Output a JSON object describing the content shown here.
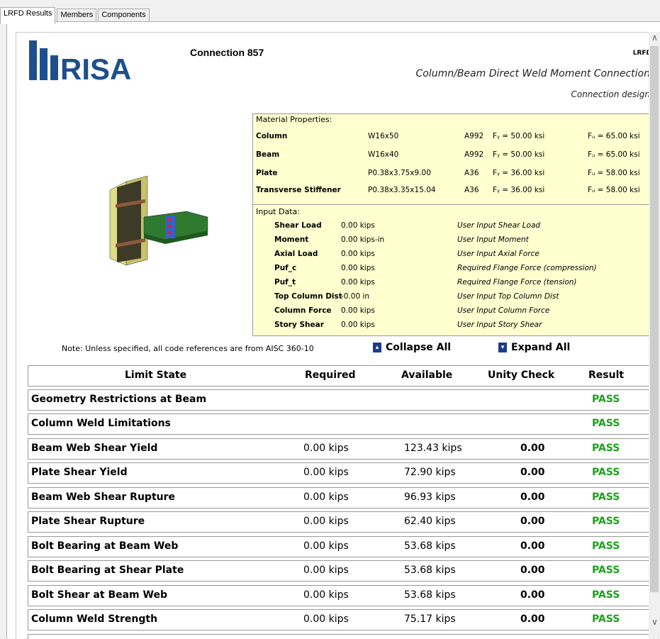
{
  "tabs": [
    "LRFD Results",
    "Members",
    "Components"
  ],
  "header": {
    "connection_title": "Connection 857",
    "design_code": "LRFD",
    "connection_type": "Column/Beam Direct Weld Moment Connection",
    "design_note": "Connection design",
    "logo_text": "RISA"
  },
  "material": {
    "title": "Material Properties:",
    "rows": [
      {
        "label": "Column",
        "shape": "W16x50",
        "grade": "A992",
        "fy": "Fᵧ = 50.00 ksi",
        "fu": "Fᵤ = 65.00 ksi"
      },
      {
        "label": "Beam",
        "shape": "W16x40",
        "grade": "A992",
        "fy": "Fᵧ = 50.00 ksi",
        "fu": "Fᵤ = 65.00 ksi"
      },
      {
        "label": "Plate",
        "shape": "P0.38x3.75x9.00",
        "grade": "A36",
        "fy": "Fᵧ = 36.00 ksi",
        "fu": "Fᵤ = 58.00 ksi"
      },
      {
        "label": "Transverse Stiffener",
        "shape": "P0.38x3.35x15.04",
        "grade": "A36",
        "fy": "Fᵧ = 36.00 ksi",
        "fu": "Fᵤ = 58.00 ksi"
      }
    ]
  },
  "input": {
    "title": "Input Data:",
    "rows": [
      {
        "label": "Shear Load",
        "value": "0.00 kips",
        "desc": "User Input Shear Load"
      },
      {
        "label": "Moment",
        "value": "0.00 kips-in",
        "desc": "User Input Moment"
      },
      {
        "label": "Axial Load",
        "value": "0.00 kips",
        "desc": "User Input Axial Force"
      },
      {
        "label": "Puf_c",
        "value": "0.00 kips",
        "desc": "Required Flange Force (compression)"
      },
      {
        "label": "Puf_t",
        "value": "0.00 kips",
        "desc": "Required Flange Force (tension)"
      },
      {
        "label": "Top Column Dist",
        "value": "-0.00 in",
        "desc": "User Input Top Column Dist"
      },
      {
        "label": "Column Force",
        "value": "0.00 kips",
        "desc": "User Input Column Force"
      },
      {
        "label": "Story Shear",
        "value": "0.00 kips",
        "desc": "User Input Story Shear"
      }
    ]
  },
  "note": "Note: Unless specified, all code references are from AISC 360-10",
  "controls": {
    "collapse": "Collapse All",
    "expand": "Expand All"
  },
  "table": {
    "headers": [
      "Limit State",
      "Required",
      "Available",
      "Unity Check",
      "Result"
    ],
    "rows": [
      {
        "limit": "Geometry Restrictions at Beam",
        "required": "",
        "available": "",
        "unity": "",
        "result": "PASS"
      },
      {
        "limit": "Column Weld Limitations",
        "required": "",
        "available": "",
        "unity": "",
        "result": "PASS"
      },
      {
        "limit": "Beam Web Shear Yield",
        "required": "0.00 kips",
        "available": "123.43 kips",
        "unity": "0.00",
        "result": "PASS"
      },
      {
        "limit": "Plate Shear Yield",
        "required": "0.00 kips",
        "available": "72.90 kips",
        "unity": "0.00",
        "result": "PASS"
      },
      {
        "limit": "Beam Web Shear Rupture",
        "required": "0.00 kips",
        "available": "96.93 kips",
        "unity": "0.00",
        "result": "PASS"
      },
      {
        "limit": "Plate Shear Rupture",
        "required": "0.00 kips",
        "available": "62.40 kips",
        "unity": "0.00",
        "result": "PASS"
      },
      {
        "limit": "Bolt Bearing at Beam Web",
        "required": "0.00 kips",
        "available": "53.68 kips",
        "unity": "0.00",
        "result": "PASS"
      },
      {
        "limit": "Bolt Bearing at Shear Plate",
        "required": "0.00 kips",
        "available": "53.68 kips",
        "unity": "0.00",
        "result": "PASS"
      },
      {
        "limit": "Bolt Shear at Beam Web",
        "required": "0.00 kips",
        "available": "53.68 kips",
        "unity": "0.00",
        "result": "PASS"
      },
      {
        "limit": "Column Weld Strength",
        "required": "0.00 kips",
        "available": "75.17 kips",
        "unity": "0.00",
        "result": "PASS"
      }
    ]
  },
  "colors": {
    "pass": "#1aa21a",
    "logo": "#1e4f8c",
    "panel": "#ffffd0"
  }
}
